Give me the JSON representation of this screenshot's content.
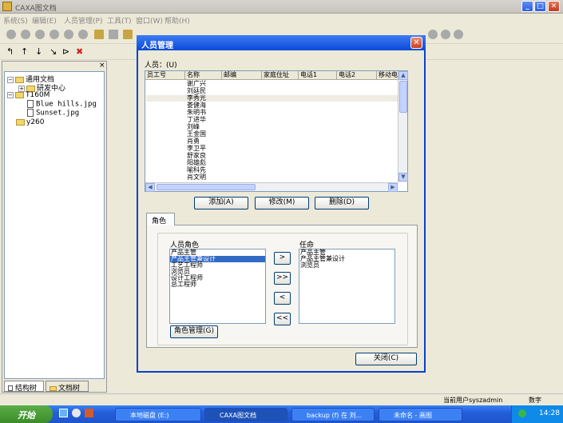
{
  "app": {
    "title": "CAXA图文档"
  },
  "menu": [
    "系统(S)",
    "编辑(E)",
    "人员管理(P)",
    "工具(T)",
    "窗口(W)",
    "帮助(H)"
  ],
  "tree": {
    "root": "通用文档",
    "child": "研发中心",
    "folder2": "T160M",
    "files": [
      "Blue hills.jpg",
      "Sunset.jpg"
    ],
    "folder3": "y260"
  },
  "left_tabs": [
    "结构树",
    "文档树"
  ],
  "dialog": {
    "title": "人员管理",
    "people_label": "人员：(U)",
    "columns": [
      "员工号",
      "名称",
      "邮编",
      "家庭住址",
      "电话1",
      "电话2",
      "移动电话"
    ],
    "names": [
      "谢广兴",
      "刘廷民",
      "李秀光",
      "娄健海",
      "朱明书",
      "丁进华",
      "刘峰",
      "王金国",
      "肖勇",
      "李卫平",
      "舒家良",
      "阳雄彪",
      "喻科先",
      "肖文明"
    ],
    "buttons": {
      "add": "添加(A)",
      "edit": "修改(M)",
      "delete": "删除(D)",
      "close": "关闭(C)",
      "role_manage": "角色管理(G)"
    },
    "tab_role": "角色",
    "person_roles_label": "人员角色",
    "person_roles": [
      "产品主管",
      "产品主管兼设计",
      "工艺工程师",
      "浏览员",
      "设计工程师",
      "总工程师"
    ],
    "selected_role": "产品主管兼设计",
    "assigned_label": "任命",
    "assigned_roles": [
      "产品主管",
      "产品主管兼设计",
      "浏览员"
    ],
    "move_buttons": [
      ">",
      ">>",
      "<",
      "<<"
    ]
  },
  "status": {
    "user": "当前用户syszadmin",
    "mode": "数字"
  },
  "taskbar": {
    "start": "开始",
    "items": [
      "本地磁盘 (E:)",
      "CAXA图文档",
      "backup (f) 在 刘...",
      "未命名 - 画图"
    ],
    "time": "14:28"
  }
}
